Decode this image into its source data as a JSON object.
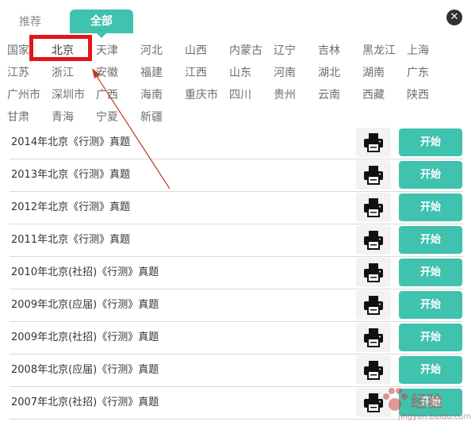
{
  "tabs": {
    "recommended": "推荐",
    "all": "全部"
  },
  "close": {
    "glyph": "✕"
  },
  "regions": [
    "国家",
    "北京",
    "天津",
    "河北",
    "山西",
    "内蒙古",
    "辽宁",
    "吉林",
    "黑龙江",
    "上海",
    "江苏",
    "浙江",
    "安徽",
    "福建",
    "江西",
    "山东",
    "河南",
    "湖北",
    "湖南",
    "广东",
    "广州市",
    "深圳市",
    "广西",
    "海南",
    "重庆市",
    "四川",
    "贵州",
    "云南",
    "西藏",
    "陕西",
    "甘肃",
    "青海",
    "宁夏",
    "新疆"
  ],
  "active_region": "北京",
  "exams": [
    "2014年北京《行测》真题",
    "2013年北京《行测》真题",
    "2012年北京《行测》真题",
    "2011年北京《行测》真题",
    "2010年北京(社招)《行测》真题",
    "2009年北京(应届)《行测》真题",
    "2009年北京(社招)《行测》真题",
    "2008年北京(应届)《行测》真题",
    "2007年北京(社招)《行测》真题"
  ],
  "start_label": "开始",
  "print_icon": "printer-icon",
  "watermark": {
    "text": "经验",
    "url": "jingyan.baidu.com"
  },
  "colors": {
    "accent": "#3fc2ae",
    "highlight": "#e3141b"
  }
}
